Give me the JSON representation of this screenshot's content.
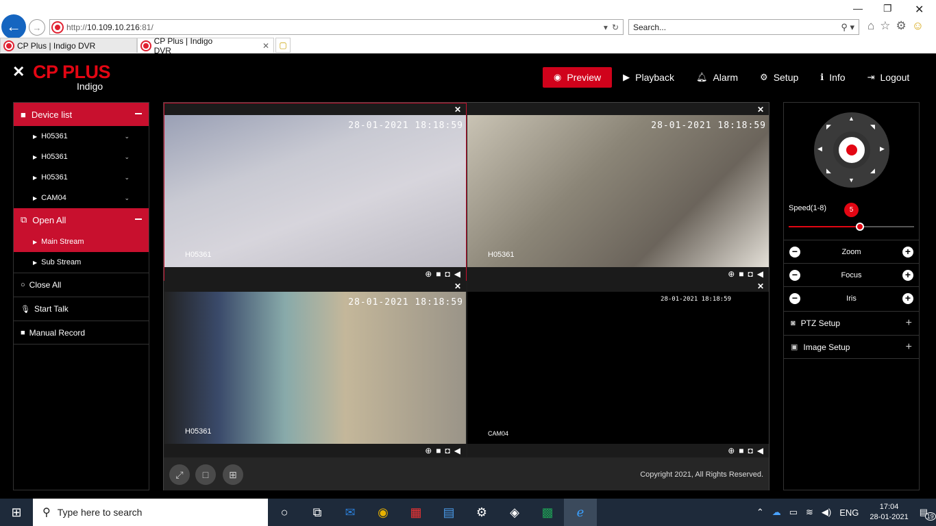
{
  "browser": {
    "url_prefix": "http://",
    "url": "10.109.10.216",
    "url_port": ":81/",
    "search_placeholder": "Search...",
    "tabs": [
      {
        "label": "CP Plus | Indigo DVR"
      },
      {
        "label": "CP Plus | Indigo DVR"
      }
    ]
  },
  "app": {
    "brand": "CP PLUS",
    "product": "Indigo",
    "nav": [
      {
        "label": "Preview",
        "active": true
      },
      {
        "label": "Playback"
      },
      {
        "label": "Alarm"
      },
      {
        "label": "Setup"
      },
      {
        "label": "Info"
      },
      {
        "label": "Logout"
      }
    ]
  },
  "left": {
    "device_list": "Device list",
    "devices": [
      "H05361",
      "H05361",
      "H05361",
      "CAM04"
    ],
    "open_all": "Open All",
    "streams": [
      "Main Stream",
      "Sub Stream"
    ],
    "close_all": "Close All",
    "start_talk": "Start Talk",
    "manual_record": "Manual Record"
  },
  "grid": {
    "cells": [
      {
        "timestamp": "28-01-2021 18:18:59",
        "camera": "H05361"
      },
      {
        "timestamp": "28-01-2021 18:18:59",
        "camera": "H05361"
      },
      {
        "timestamp": "28-01-2021 18:18:59",
        "camera": "H05361"
      },
      {
        "timestamp": "28-01-2021 18:18:59",
        "camera": "CAM04"
      }
    ],
    "copyright": "Copyright 2021, All Rights Reserved."
  },
  "right": {
    "speed_label": "Speed(1-8)",
    "speed_value": "5",
    "speed_fraction": 0.57,
    "zoom": "Zoom",
    "focus": "Focus",
    "iris": "Iris",
    "ptz_setup": "PTZ Setup",
    "image_setup": "Image Setup"
  },
  "taskbar": {
    "search_placeholder": "Type here to search",
    "lang": "ENG",
    "time": "17:04",
    "date": "28-01-2021",
    "notifications": "19"
  },
  "colors": {
    "accent": "#c8102e",
    "brand_red": "#e30613"
  }
}
